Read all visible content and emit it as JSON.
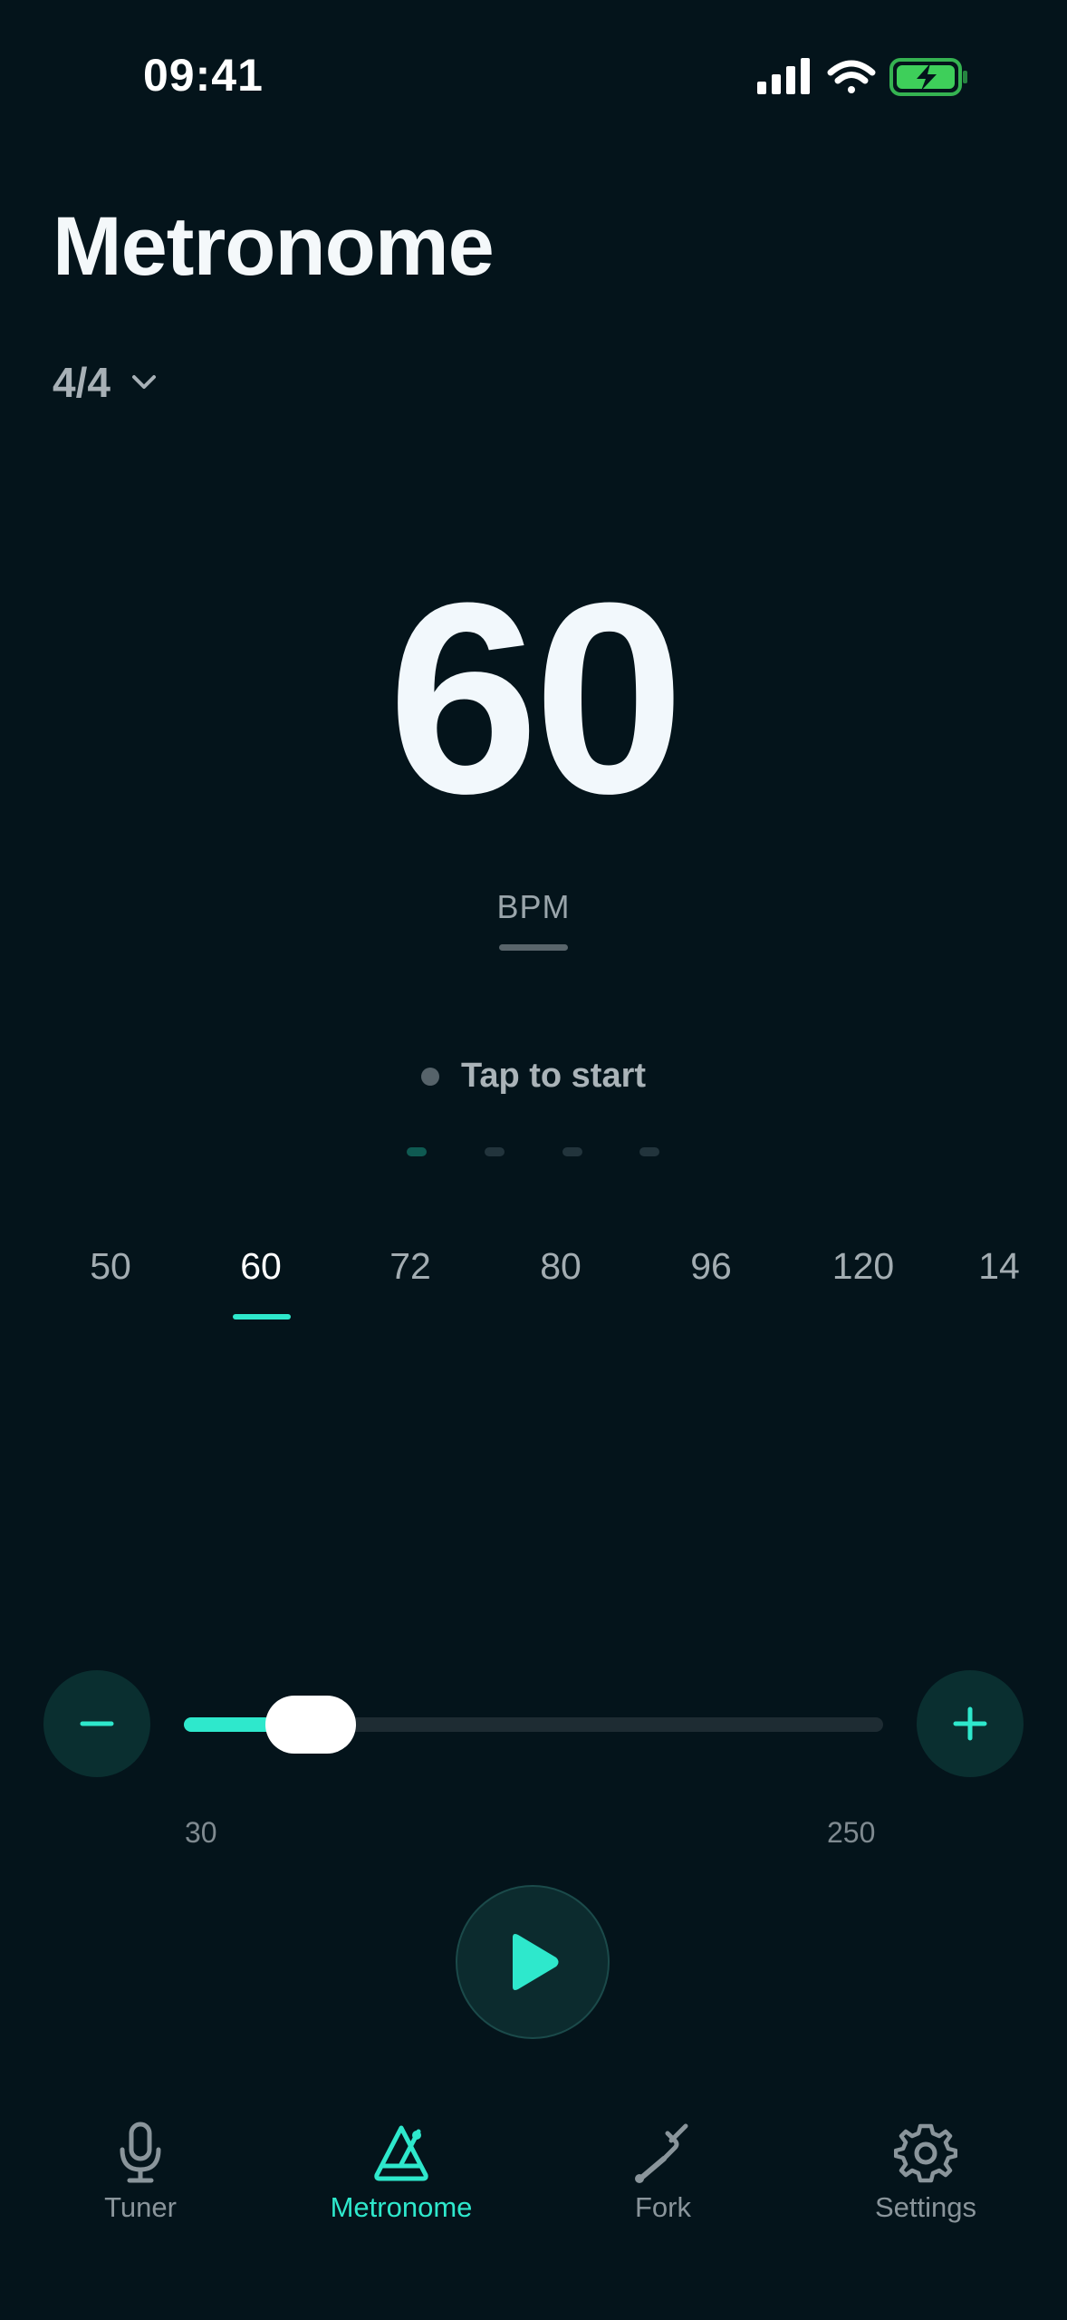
{
  "status_bar": {
    "time": "09:41"
  },
  "header": {
    "title": "Metronome",
    "time_signature": "4/4"
  },
  "tempo": {
    "bpm": "60",
    "unit": "BPM",
    "tap_label": "Tap to start",
    "beats": 4,
    "active_beat": 1
  },
  "presets": {
    "items": [
      "50",
      "60",
      "72",
      "80",
      "96",
      "120",
      "14"
    ],
    "selected": "60"
  },
  "slider": {
    "min_label": "30",
    "max_label": "250",
    "value": 60,
    "min": 30,
    "max": 250
  },
  "tab_bar": {
    "items": [
      {
        "label": "Tuner",
        "icon": "microphone-icon"
      },
      {
        "label": "Metronome",
        "icon": "metronome-icon"
      },
      {
        "label": "Fork",
        "icon": "tuning-fork-icon"
      },
      {
        "label": "Settings",
        "icon": "gear-icon"
      }
    ],
    "active": "Metronome"
  },
  "colors": {
    "background": "#04141b",
    "accent": "#2ee8cc",
    "battery": "#3ecf5a"
  }
}
